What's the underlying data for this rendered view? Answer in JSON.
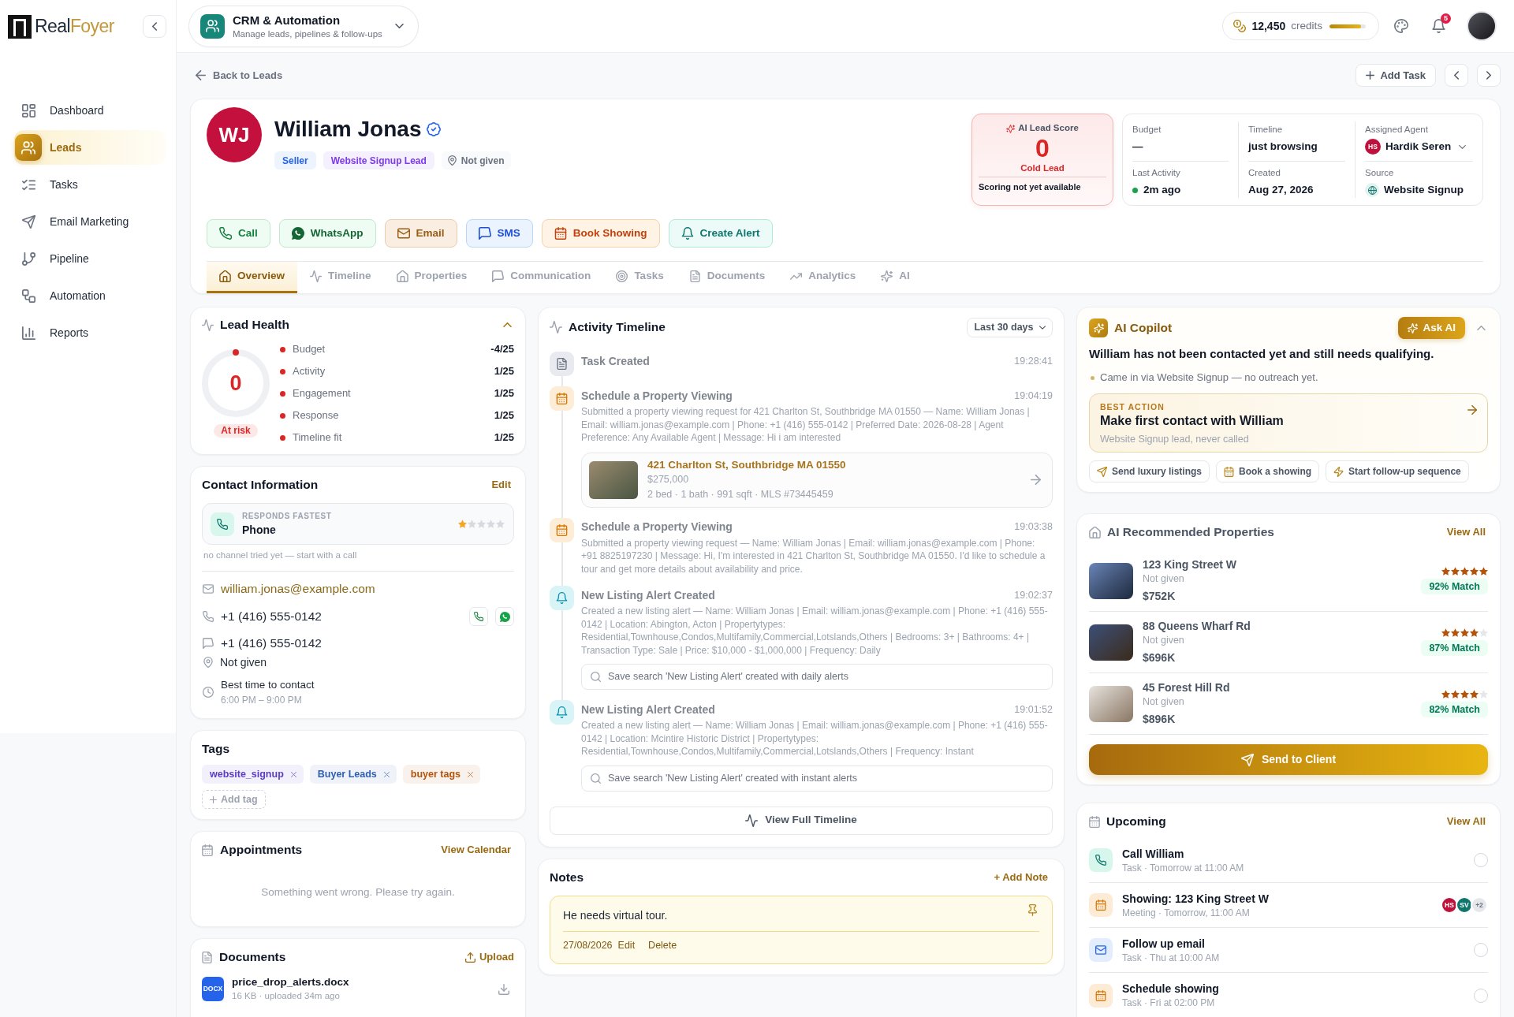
{
  "sidebar": {
    "logo": [
      "Real",
      "Foyer"
    ],
    "items": [
      {
        "label": "Dashboard",
        "selected": false
      },
      {
        "label": "Leads",
        "selected": true
      },
      {
        "label": "Tasks",
        "selected": false
      },
      {
        "label": "Email Marketing",
        "selected": false
      },
      {
        "label": "Pipeline",
        "selected": false
      },
      {
        "label": "Automation",
        "selected": false
      },
      {
        "label": "Reports",
        "selected": false
      }
    ]
  },
  "header": {
    "module": {
      "title": "CRM & Automation",
      "subtitle": "Manage leads, pipelines & follow-ups"
    },
    "credits": {
      "amount": "12,450",
      "label": "credits",
      "level": 0.88
    },
    "notifications": {
      "count": "5"
    }
  },
  "toolbar": {
    "back_link": "Back to Leads",
    "add_task": "Add Task"
  },
  "lead": {
    "initials": "WJ",
    "name": "William Jonas",
    "verified": true,
    "badges": [
      {
        "kind": "role",
        "label": "Seller"
      },
      {
        "kind": "source",
        "label": "Website Signup Lead"
      },
      {
        "kind": "location",
        "label": "Not given"
      }
    ],
    "actions": [
      {
        "kind": "call",
        "label": "Call"
      },
      {
        "kind": "whatsapp",
        "label": "WhatsApp"
      },
      {
        "kind": "email",
        "label": "Email"
      },
      {
        "kind": "sms",
        "label": "SMS"
      },
      {
        "kind": "showing",
        "label": "Book Showing"
      },
      {
        "kind": "alert",
        "label": "Create Alert"
      }
    ],
    "score": {
      "label": "AI Lead Score",
      "value": "0",
      "category": "Cold Lead",
      "note": "Scoring not yet available"
    },
    "details": [
      {
        "kind": "text",
        "label": "Budget",
        "value": "—"
      },
      {
        "kind": "text",
        "label": "Timeline",
        "value": "just browsing"
      },
      {
        "kind": "agent",
        "label": "Assigned Agent",
        "value": "Hardik Seren",
        "initials": "HS"
      },
      {
        "kind": "activity",
        "label": "Last Activity",
        "value": "2m ago"
      },
      {
        "kind": "text",
        "label": "Created",
        "value": "Aug 27, 2026"
      },
      {
        "kind": "source",
        "label": "Source",
        "value": "Website Signup"
      }
    ],
    "tabs": [
      {
        "label": "Overview",
        "selected": true
      },
      {
        "label": "Timeline",
        "selected": false
      },
      {
        "label": "Properties",
        "selected": false
      },
      {
        "label": "Communication",
        "selected": false
      },
      {
        "label": "Tasks",
        "selected": false
      },
      {
        "label": "Documents",
        "selected": false
      },
      {
        "label": "Analytics",
        "selected": false
      },
      {
        "label": "AI",
        "selected": false
      }
    ]
  },
  "lead_health": {
    "title": "Lead Health",
    "expanded": true,
    "score": "0",
    "level": 0,
    "status": "At risk",
    "factors": [
      {
        "label": "Budget",
        "value": "-4/25"
      },
      {
        "label": "Activity",
        "value": "1/25"
      },
      {
        "label": "Engagement",
        "value": "1/25"
      },
      {
        "label": "Response",
        "value": "1/25"
      },
      {
        "label": "Timeline fit",
        "value": "1/25"
      }
    ]
  },
  "contact": {
    "title": "Contact Information",
    "edit": "Edit",
    "fastest": {
      "label": "RESPONDS FASTEST",
      "channel": "Phone",
      "stars": 1
    },
    "hint": "no channel tried yet — start with a call",
    "rows": [
      {
        "kind": "email",
        "value": "william.jonas@example.com"
      },
      {
        "kind": "phone",
        "value": "+1 (416) 555-0142"
      },
      {
        "kind": "sms",
        "value": "+1 (416) 555-0142"
      },
      {
        "kind": "location",
        "value": "Not given"
      },
      {
        "kind": "time",
        "value": "Best time to contact",
        "detail": "6:00 PM – 9:00 PM"
      }
    ]
  },
  "tags": {
    "title": "Tags",
    "items": [
      {
        "label": "website_signup",
        "color": "#5b3cc4"
      },
      {
        "label": "Buyer Leads",
        "color": "#2f5fb3"
      },
      {
        "label": "buyer tags",
        "color": "#b45309"
      }
    ],
    "add": "Add tag"
  },
  "appointments": {
    "title": "Appointments",
    "link": "View Calendar",
    "message": "Something went wrong. Please try again."
  },
  "documents": {
    "title": "Documents",
    "upload": "Upload",
    "files": [
      {
        "type": "DOCX",
        "name": "price_drop_alerts.docx",
        "meta": "16 KB · uploaded 34m ago"
      }
    ]
  },
  "timeline": {
    "title": "Activity Timeline",
    "filter": "Last 30 days",
    "events": [
      {
        "kind": "task",
        "title": "Task Created",
        "time": "19:28:41"
      },
      {
        "kind": "viewing",
        "title": "Schedule a Property Viewing",
        "time": "19:04:19",
        "description": "Submitted a property viewing request for 421 Charlton St, Southbridge MA 01550 — Name: William Jonas | Email: william.jonas@example.com | Phone: +1 (416) 555-0142 | Preferred Date: 2026-08-28 | Agent Preference: Any Available Agent | Message: Hi i am interested",
        "property": {
          "address": "421 Charlton St, Southbridge MA 01550",
          "price": "$275,000",
          "details": "2 bed · 1 bath · 991 sqft · MLS #73445459"
        }
      },
      {
        "kind": "viewing",
        "title": "Schedule a Property Viewing",
        "time": "19:03:38",
        "description": "Submitted a property viewing request — Name: William Jonas | Email: william.jonas@example.com | Phone: +91 8825197230 | Message: Hi, I'm interested in 421 Charlton St, Southbridge MA 01550. I'd like to schedule a tour and get more details about availability and price."
      },
      {
        "kind": "alert",
        "title": "New Listing Alert Created",
        "time": "19:02:37",
        "description": "Created a new listing alert — Name: William Jonas | Email: william.jonas@example.com | Phone: +1 (416) 555-0142 | Location: Abington, Acton | Propertytypes: Residential,Townhouse,Condos,Multifamily,Commercial,Lotslands,Others | Bedrooms: 3+ | Bathrooms: 4+ | Transaction Type: Sale | Price: $10,000 - $1,000,000 | Frequency: Daily",
        "saved_search": "Save search 'New Listing Alert' created with daily alerts"
      },
      {
        "kind": "alert",
        "title": "New Listing Alert Created",
        "time": "19:01:52",
        "description": "Created a new listing alert — Name: William Jonas | Email: william.jonas@example.com | Phone: +1 (416) 555-0142 | Location: Mcintire Historic District | Propertytypes: Residential,Townhouse,Condos,Multifamily,Commercial,Lotslands,Others | Frequency: Instant",
        "saved_search": "Save search 'New Listing Alert' created with instant alerts"
      }
    ],
    "view_full": "View Full Timeline"
  },
  "notes": {
    "title": "Notes",
    "add": "+ Add Note",
    "items": [
      {
        "text": "He needs virtual tour.",
        "date": "27/08/2026",
        "actions": [
          "Edit",
          "Delete"
        ]
      }
    ]
  },
  "copilot": {
    "title": "AI Copilot",
    "ask": "Ask AI",
    "expanded": true,
    "headline": "William has not been contacted yet and still needs qualifying.",
    "points": [
      "Came in via Website Signup — no outreach yet."
    ],
    "best_action": {
      "label": "BEST ACTION",
      "title": "Make first contact with William",
      "detail": "Website Signup lead, never called"
    },
    "suggestions": [
      "Send luxury listings",
      "Book a showing",
      "Start follow-up sequence"
    ]
  },
  "recommended": {
    "title": "AI Recommended Properties",
    "link": "View All",
    "properties": [
      {
        "address": "123 King Street W",
        "location": "Not given",
        "price": "$752K",
        "stars": 5,
        "match": "92% Match"
      },
      {
        "address": "88 Queens Wharf Rd",
        "location": "Not given",
        "price": "$696K",
        "stars": 4,
        "match": "87% Match"
      },
      {
        "address": "45 Forest Hill Rd",
        "location": "Not given",
        "price": "$896K",
        "stars": 4,
        "match": "82% Match"
      }
    ],
    "send": "Send to Client"
  },
  "upcoming": {
    "title": "Upcoming",
    "link": "View All",
    "items": [
      {
        "kind": "call",
        "title": "Call William",
        "meta": "Task · Tomorrow at 11:00 AM",
        "done": false
      },
      {
        "kind": "meeting",
        "title": "Showing: 123 King Street W",
        "meta": "Meeting · Tomorrow, 11:00 AM",
        "attendees": [
          {
            "initials": "HS",
            "color": "#be123c"
          },
          {
            "initials": "SV",
            "color": "#0f766e"
          }
        ],
        "more": "+2"
      },
      {
        "kind": "email",
        "title": "Follow up email",
        "meta": "Task · Thu at 10:00 AM",
        "done": false
      },
      {
        "kind": "showing",
        "title": "Schedule showing",
        "meta": "Task · Fri at 02:00 PM",
        "done": false
      }
    ]
  }
}
